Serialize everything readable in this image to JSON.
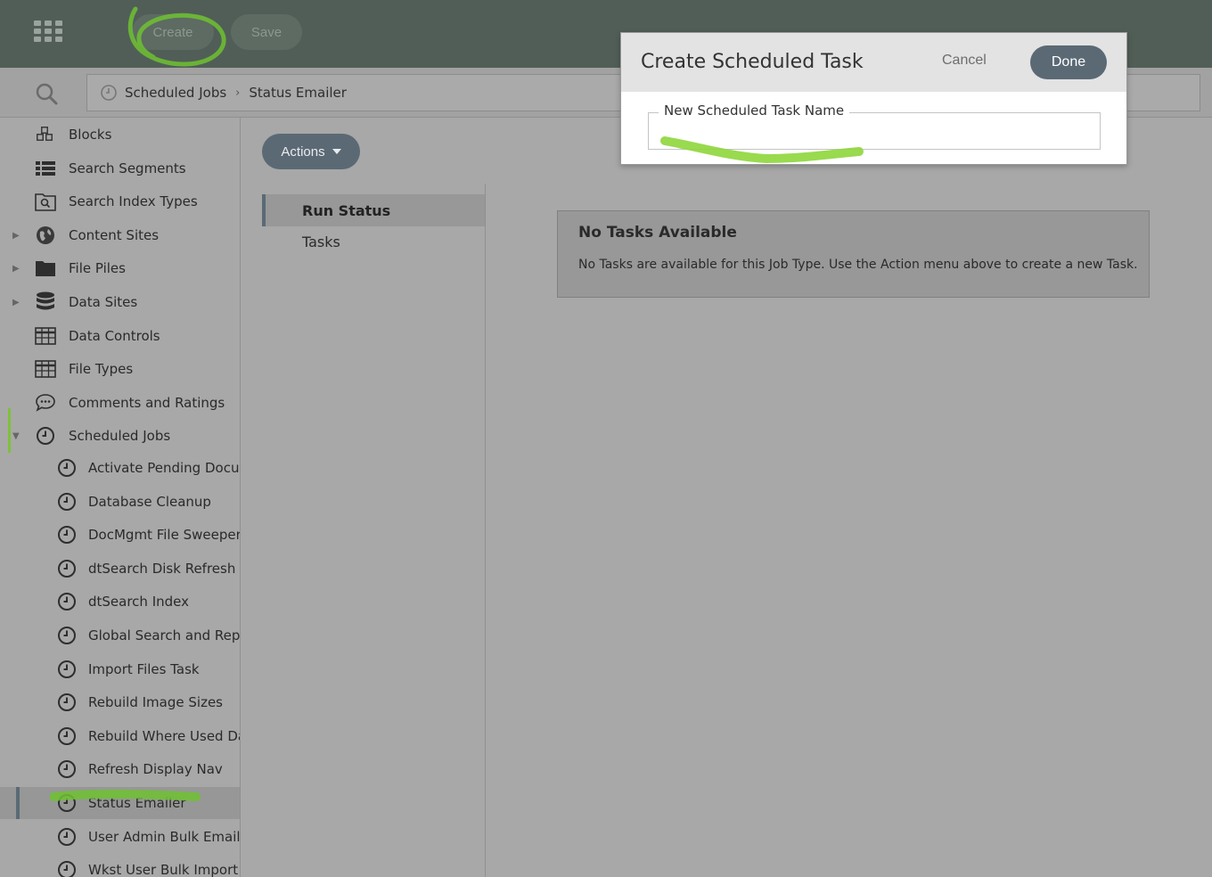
{
  "topbar": {
    "create_label": "Create",
    "save_label": "Save"
  },
  "breadcrumb": {
    "items": [
      "Scheduled Jobs",
      "Status Emailer"
    ]
  },
  "sidebar": {
    "items": [
      {
        "label": "Blocks",
        "icon": "blocks-icon"
      },
      {
        "label": "Search Segments",
        "icon": "list-icon"
      },
      {
        "label": "Search Index Types",
        "icon": "search-index-icon"
      },
      {
        "label": "Content Sites",
        "icon": "globe-icon"
      },
      {
        "label": "File Piles",
        "icon": "folder-icon"
      },
      {
        "label": "Data Sites",
        "icon": "database-icon"
      },
      {
        "label": "Data Controls",
        "icon": "table-icon"
      },
      {
        "label": "File Types",
        "icon": "table-icon"
      },
      {
        "label": "Comments and Ratings",
        "icon": "comment-icon"
      },
      {
        "label": "Scheduled Jobs",
        "icon": "clock-icon"
      }
    ],
    "jobs": [
      "Activate Pending Documents",
      "Database Cleanup",
      "DocMgmt File Sweeper",
      "dtSearch Disk Refresh",
      "dtSearch Index",
      "Global Search and Replace",
      "Import Files Task",
      "Rebuild Image Sizes",
      "Rebuild Where Used Data",
      "Refresh Display Nav",
      "Status Emailer",
      "User Admin Bulk Emailer",
      "Wkst User Bulk Import"
    ],
    "selected_job": "Status Emailer"
  },
  "main": {
    "actions_label": "Actions",
    "tabs": [
      "Run Status",
      "Tasks"
    ],
    "active_tab": "Run Status",
    "notice_title": "No Tasks Available",
    "notice_text": "No Tasks are available for this Job Type. Use the Action menu above to create a new Task."
  },
  "modal": {
    "title": "Create Scheduled Task",
    "cancel_label": "Cancel",
    "done_label": "Done",
    "field_label": "New Scheduled Task Name",
    "field_value": ""
  },
  "colors": {
    "topbar": "#515e57",
    "accent_button": "#5b6975",
    "highlight_marker": "#7ec13a",
    "background": "#a7a8a7"
  }
}
